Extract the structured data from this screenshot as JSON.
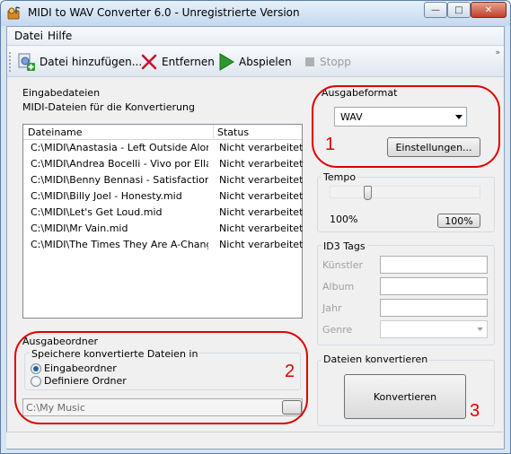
{
  "window": {
    "title": "MIDI to WAV Converter 6.0  -  Unregistrierte Version",
    "min_label": "—",
    "max_label": "□",
    "close_label": "✕"
  },
  "menu": {
    "file": "Datei",
    "help": "Hilfe"
  },
  "toolbar": {
    "add_files": "Datei hinzufügen...",
    "remove": "Entfernen",
    "play": "Abspielen",
    "stop": "Stopp",
    "chevron": "»"
  },
  "input_files": {
    "group_label": "Eingabedateien",
    "subtitle": "MIDI-Dateien für die Konvertierung",
    "columns": [
      "Dateiname",
      "Status"
    ],
    "rows": [
      {
        "name": "C:\\MIDI\\Anastasia - Left Outside Alon...",
        "status": "Nicht verarbeitet"
      },
      {
        "name": "C:\\MIDI\\Andrea Bocelli - Vivo por Ella....",
        "status": "Nicht verarbeitet"
      },
      {
        "name": "C:\\MIDI\\Benny Bennasi - Satisfaction....",
        "status": "Nicht verarbeitet"
      },
      {
        "name": "C:\\MIDI\\Billy Joel - Honesty.mid",
        "status": "Nicht verarbeitet"
      },
      {
        "name": "C:\\MIDI\\Let's Get Loud.mid",
        "status": "Nicht verarbeitet"
      },
      {
        "name": "C:\\MIDI\\Mr Vain.mid",
        "status": "Nicht verarbeitet"
      },
      {
        "name": "C:\\MIDI\\The Times They Are A-Changi...",
        "status": "Nicht verarbeitet"
      }
    ]
  },
  "output_format": {
    "group_label": "Ausgabeformat",
    "selected": "WAV",
    "settings_button": "Einstellungen..."
  },
  "tempo": {
    "group_label": "Tempo",
    "value_label": "100%",
    "button_label": "100%",
    "level_percent": 100
  },
  "id3": {
    "group_label": "ID3 Tags",
    "artist": "Künstler",
    "album": "Album",
    "year": "Jahr",
    "genre": "Genre"
  },
  "output_folder": {
    "group_label": "Ausgabeordner",
    "save_label": "Speichere konvertierte Dateien in",
    "option_input": "Eingabeordner",
    "option_custom": "Definiere Ordner",
    "path": "C:\\My Music"
  },
  "convert": {
    "group_label": "Dateien konvertieren",
    "button": "Konvertieren"
  },
  "annotations": [
    "1",
    "2",
    "3"
  ],
  "colors": {
    "annotation": "#e00000",
    "play_icon": "#2a9a2a",
    "remove_icon": "#c8102e"
  }
}
